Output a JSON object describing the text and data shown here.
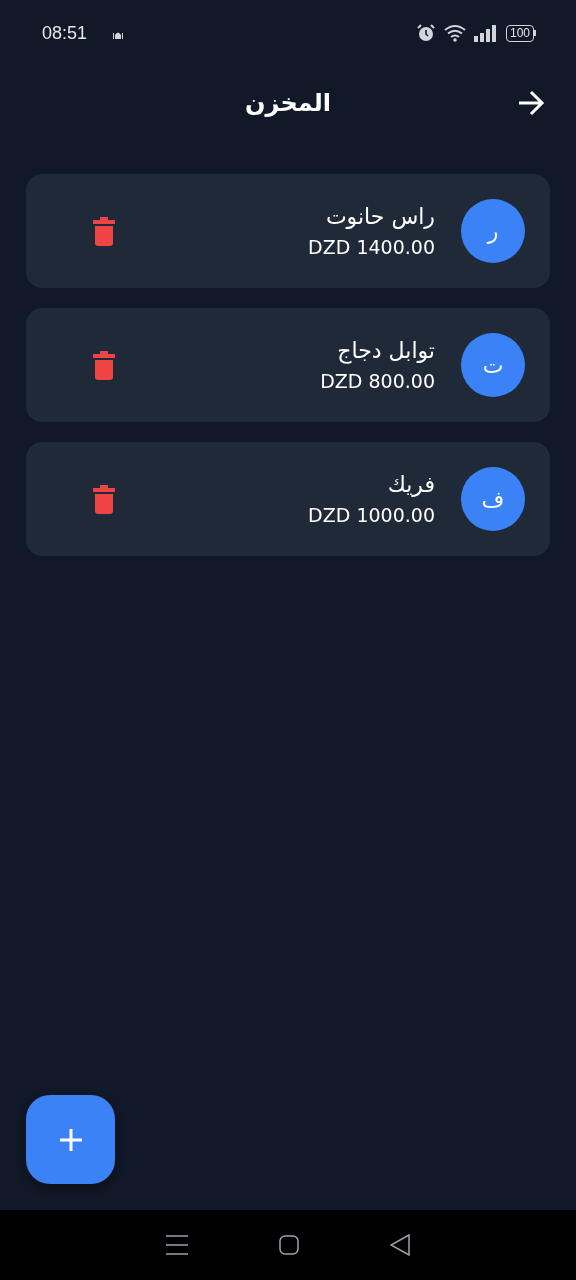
{
  "status_bar": {
    "time": "08:51",
    "battery": "100"
  },
  "header": {
    "title": "المخزن"
  },
  "items": [
    {
      "initial": "ر",
      "name": "راس حانوت",
      "price": "DZD 1400.00"
    },
    {
      "initial": "ت",
      "name": "توابل دجاج",
      "price": "DZD 800.00"
    },
    {
      "initial": "ف",
      "name": "فريك",
      "price": "DZD 1000.00"
    }
  ]
}
